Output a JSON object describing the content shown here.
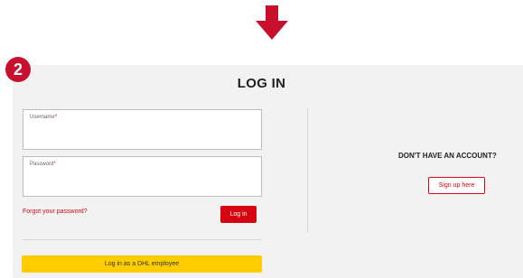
{
  "step": {
    "number": "2"
  },
  "header": {
    "title": "LOG IN"
  },
  "form": {
    "username": {
      "label": "Username",
      "required_mark": "*",
      "value": ""
    },
    "password": {
      "label": "Password",
      "required_mark": "*",
      "value": ""
    },
    "forgot_link": "Forgot your password?",
    "login_button": "Log in",
    "employee_button": "Log in as a DHL employee"
  },
  "signup": {
    "prompt": "DON'T HAVE AN ACCOUNT?",
    "button": "Sign up here"
  },
  "colors": {
    "brand_red": "#d40511",
    "brand_yellow": "#ffcc00",
    "panel_bg": "#f2f2f2",
    "arrow": "#c8102e"
  },
  "icons": {
    "arrow": "down-arrow-icon"
  }
}
